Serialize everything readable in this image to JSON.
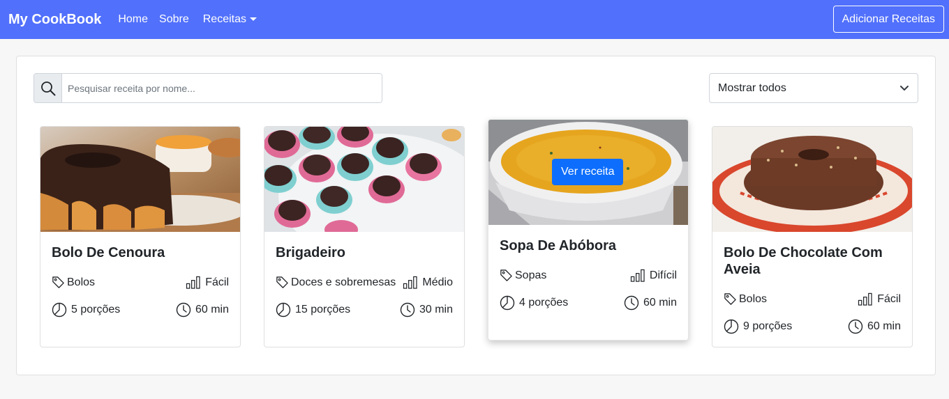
{
  "navbar": {
    "brand": "My CookBook",
    "links": [
      "Home",
      "Sobre"
    ],
    "dropdown_label": "Receitas",
    "add_button": "Adicionar Receitas",
    "background": "#5170fb"
  },
  "filters": {
    "search_placeholder": "Pesquisar receita por nome...",
    "select_value": "Mostrar todos"
  },
  "recipes": [
    {
      "title": "Bolo De Cenoura",
      "category": "Bolos",
      "difficulty": "Fácil",
      "portions": "5 porções",
      "time": "60 min"
    },
    {
      "title": "Brigadeiro",
      "category": "Doces e sobremesas",
      "difficulty": "Médio",
      "portions": "15 porções",
      "time": "30 min"
    },
    {
      "title": "Sopa De Abóbora",
      "category": "Sopas",
      "difficulty": "Difícil",
      "portions": "4 porções",
      "time": "60 min",
      "hover_button": "Ver receita"
    },
    {
      "title": "Bolo De Chocolate Com Aveia",
      "category": "Bolos",
      "difficulty": "Fácil",
      "portions": "9 porções",
      "time": "60 min"
    }
  ]
}
